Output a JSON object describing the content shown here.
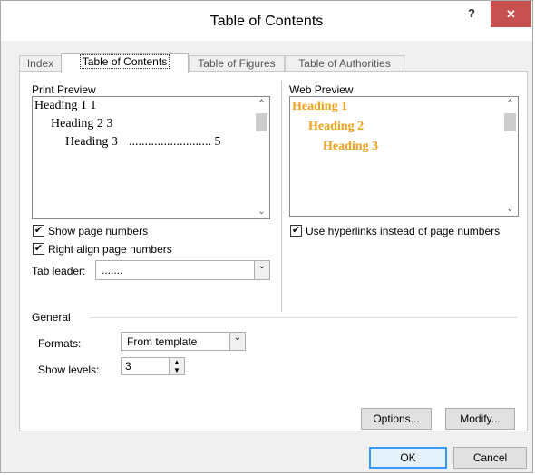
{
  "window": {
    "title": "Table of Contents",
    "help": "?",
    "close": "✕"
  },
  "tabs": [
    {
      "label": "Index"
    },
    {
      "label": "Table of Contents"
    },
    {
      "label": "Table of Figures"
    },
    {
      "label": "Table of Authorities"
    }
  ],
  "print_preview": {
    "label": "Print Preview",
    "lines": [
      "Heading 1 1",
      "Heading 2 3",
      "Heading 3",
      ".......................... 5"
    ]
  },
  "web_preview": {
    "label": "Web Preview",
    "lines": [
      "Heading 1",
      "Heading 2",
      "Heading 3"
    ],
    "link_color": "#f0a018"
  },
  "options": {
    "show_page_numbers": "Show page numbers",
    "right_align": "Right align page numbers",
    "use_hyperlinks": "Use hyperlinks instead of page numbers",
    "tab_leader_label": "Tab leader:",
    "tab_leader_value": "......."
  },
  "general": {
    "label": "General",
    "formats_label": "Formats:",
    "formats_value": "From template",
    "show_levels_label": "Show levels:",
    "show_levels_value": "3"
  },
  "buttons": {
    "options": "Options...",
    "modify": "Modify...",
    "ok": "OK",
    "cancel": "Cancel"
  }
}
